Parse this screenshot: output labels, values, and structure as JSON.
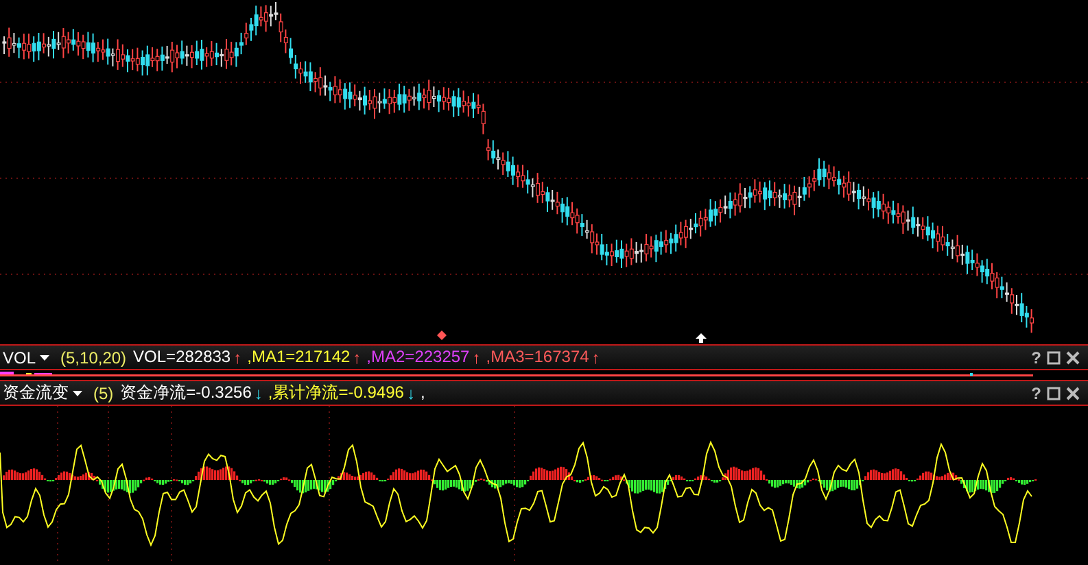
{
  "volume_header": {
    "name": "VOL",
    "params": "(5,10,20)",
    "help": "?",
    "items": [
      {
        "text": "VOL=282833",
        "color": "#ffffff",
        "arrow": "↑"
      },
      {
        "text": ",MA1=217142",
        "color": "#ffff33",
        "arrow": "↑"
      },
      {
        "text": ",MA2=223257",
        "color": "#e040fb",
        "arrow": "↑"
      },
      {
        "text": ",MA3=167374",
        "color": "#ff5a5a",
        "arrow": "↑"
      }
    ]
  },
  "flow_header": {
    "name": "资金流变",
    "params": "(5)",
    "help": "?",
    "items": [
      {
        "text": "资金净流=-0.3256",
        "color": "#ffffff",
        "arrow": "↓"
      },
      {
        "text": ",累计净流=-0.9496",
        "color": "#ffff33",
        "arrow": "↓"
      },
      {
        "text": ",",
        "color": "#ffffff"
      }
    ]
  }
}
